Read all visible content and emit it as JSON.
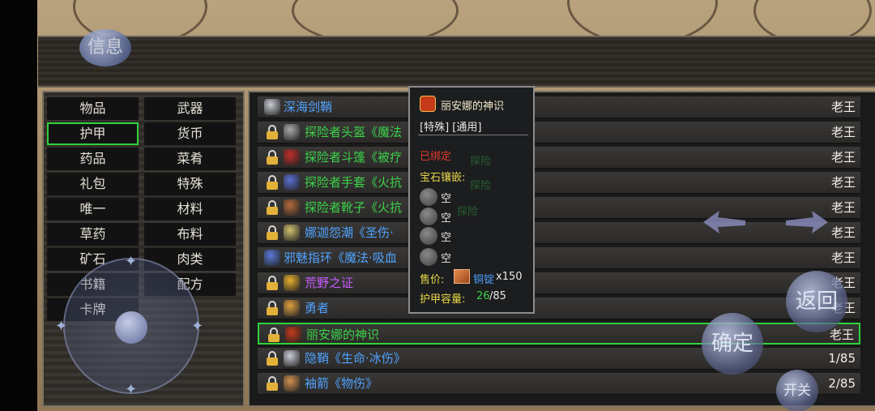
{
  "header": {
    "info_label": "信息"
  },
  "categories": {
    "left": [
      "物品",
      "护甲",
      "药品",
      "礼包",
      "唯一",
      "草药",
      "矿石",
      "书籍",
      "卡牌"
    ],
    "right": [
      "武器",
      "货币",
      "菜肴",
      "特殊",
      "材料",
      "布料",
      "肉类",
      "配方"
    ],
    "selected": "护甲"
  },
  "items": [
    {
      "name": "深海剑鞘",
      "owner": "老王",
      "color": "#4fa3ff",
      "locked": false,
      "icon": "sword-icon"
    },
    {
      "name": "探险者头盔《魔法",
      "owner": "老王",
      "color": "#3bd24a",
      "locked": true,
      "icon": "helmet-icon"
    },
    {
      "name": "探险者斗篷《被疗",
      "owner": "老王",
      "color": "#3bd24a",
      "locked": true,
      "icon": "cloak-icon"
    },
    {
      "name": "探险者手套《火抗",
      "owner": "老王",
      "color": "#3bd24a",
      "locked": true,
      "icon": "glove-icon"
    },
    {
      "name": "探险者靴子《火抗",
      "owner": "老王",
      "color": "#3bd24a",
      "locked": true,
      "icon": "boot-icon"
    },
    {
      "name": "娜迦怨潮《圣伤·",
      "owner": "老王",
      "color": "#4fa3ff",
      "locked": true,
      "icon": "amulet-icon"
    },
    {
      "name": "邪魅指环《魔法·吸血",
      "owner": "老王",
      "color": "#4fa3ff",
      "locked": false,
      "icon": "ring-icon"
    },
    {
      "name": "荒野之证",
      "owner": "老王",
      "color": "#c95cff",
      "locked": true,
      "icon": "badge-icon"
    },
    {
      "name": "勇者",
      "owner": "老王",
      "color": "#4fa3ff",
      "locked": true,
      "icon": "scroll-icon"
    },
    {
      "name": "丽安娜的神识",
      "owner": "老王",
      "color": "#3bd24a",
      "locked": true,
      "icon": "emblem-icon",
      "selected": true
    },
    {
      "name": "隐鞘《生命·冰伤》",
      "owner": "1/85",
      "color": "#4fa3ff",
      "locked": true,
      "icon": "sword-icon"
    },
    {
      "name": "袖箭《物伤》",
      "owner": "2/85",
      "color": "#4fa3ff",
      "locked": true,
      "icon": "bow-icon"
    }
  ],
  "tooltip": {
    "title": "丽安娜的神识",
    "tags": "[特殊] [通用]",
    "bound": "已绑定",
    "gem_label": "宝石镶嵌:",
    "slots": [
      "空",
      "空",
      "空",
      "空"
    ],
    "price_label": "售价:",
    "price_currency": "铜锭",
    "price_amount": "x150",
    "capacity_label": "护甲容量:",
    "capacity_current": "26",
    "capacity_max": "/85",
    "ghost_text_1": "探险",
    "ghost_text_2": "探险",
    "ghost_text_3": "探险",
    "ghost_text_4": "探险"
  },
  "controls": {
    "return_label": "返回",
    "confirm_label": "确定",
    "toggle_label": "开关"
  }
}
